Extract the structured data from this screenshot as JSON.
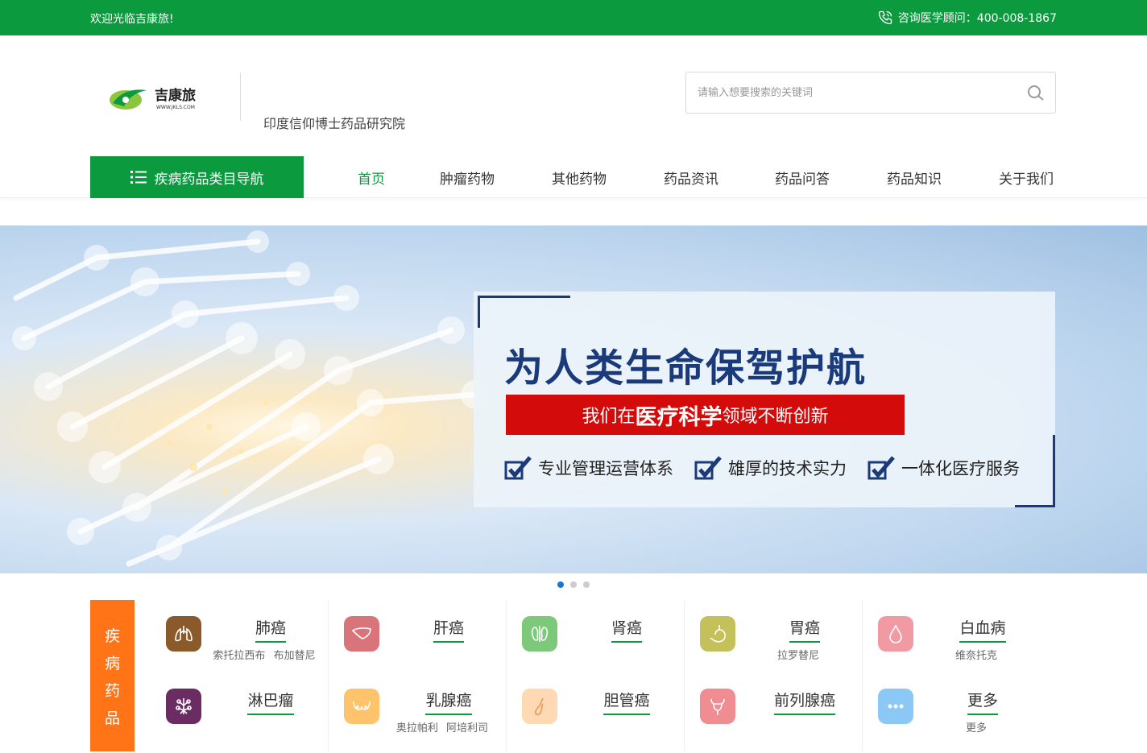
{
  "topbar": {
    "welcome": "欢迎光临吉康旅!",
    "hotline": "咨询医学顾问：400-008-1867"
  },
  "header": {
    "logo_text": "吉康旅",
    "logo_url_text": "WWW.JKLS.COM",
    "subtitle": "印度信仰博士药品研究院",
    "search_placeholder": "请输入想要搜索的关键词"
  },
  "nav": {
    "category_button": "疾病药品类目导航",
    "items": [
      {
        "label": "首页",
        "active": true
      },
      {
        "label": "肿瘤药物"
      },
      {
        "label": "其他药物"
      },
      {
        "label": "药品资讯"
      },
      {
        "label": "药品问答"
      },
      {
        "label": "药品知识"
      },
      {
        "label": "关于我们"
      }
    ]
  },
  "banner": {
    "headline": "为人类生命保驾护航",
    "sub_prefix": "我们在",
    "sub_highlight": "医疗科学",
    "sub_suffix": "领域不断创新",
    "features": [
      "专业管理运营体系",
      "雄厚的技术实力",
      "一体化医疗服务"
    ],
    "slides": 3,
    "active_slide": 1
  },
  "disease_section": {
    "label_chars": [
      "疾",
      "病",
      "药",
      "品"
    ],
    "items": [
      {
        "name": "肺癌",
        "drugs": "索托拉西布 布加替尼",
        "icon": "lungs-icon",
        "color": "#8a5a2b"
      },
      {
        "name": "肝癌",
        "drugs": "",
        "icon": "liver-icon",
        "color": "#d9757a"
      },
      {
        "name": "肾癌",
        "drugs": "",
        "icon": "kidney-icon",
        "color": "#7cc97a"
      },
      {
        "name": "胃癌",
        "drugs": "拉罗替尼",
        "icon": "stomach-icon",
        "color": "#c5c15a"
      },
      {
        "name": "白血病",
        "drugs": "维奈托克",
        "icon": "blood-drop-icon",
        "color": "#f29aa3"
      },
      {
        "name": "淋巴瘤",
        "drugs": "",
        "icon": "lymph-icon",
        "color": "#6b2c63"
      },
      {
        "name": "乳腺癌",
        "drugs": "奥拉帕利 阿培利司",
        "icon": "breast-icon",
        "color": "#ffc46b"
      },
      {
        "name": "胆管癌",
        "drugs": "",
        "icon": "gallbladder-icon",
        "color": "#ffd9b3"
      },
      {
        "name": "前列腺癌",
        "drugs": "",
        "icon": "prostate-icon",
        "color": "#ef8d92"
      },
      {
        "name": "更多",
        "drugs": "更多",
        "icon": "more-icon",
        "color": "#8cc8f5"
      }
    ]
  }
}
